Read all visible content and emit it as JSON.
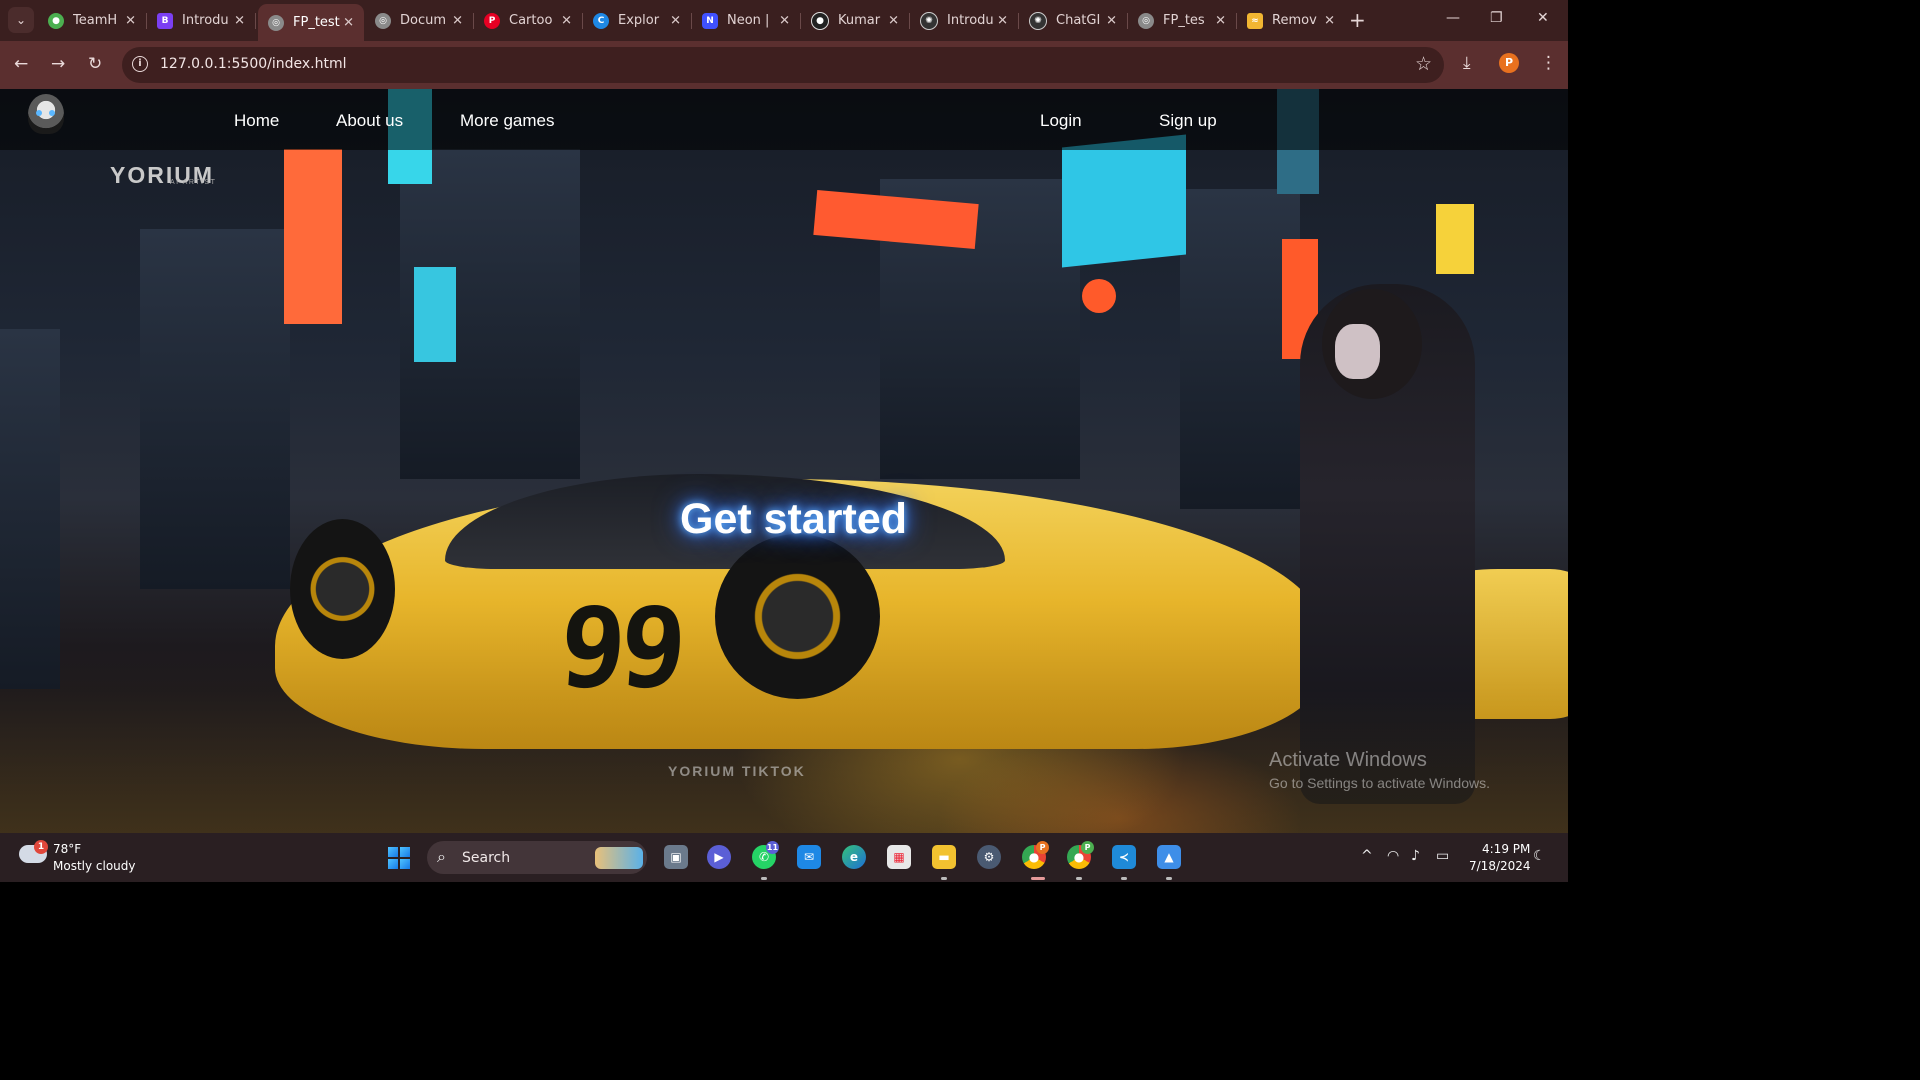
{
  "browser": {
    "tabs": [
      {
        "title": "TeamH",
        "icon": "teamh-favicon",
        "color": "#4caf50"
      },
      {
        "title": "Introdu",
        "icon": "bootstrap-favicon",
        "color": "#7b3ff2"
      },
      {
        "title": "FP_test",
        "icon": "globe-favicon",
        "color": "#8a8a8a",
        "active": true
      },
      {
        "title": "Docum",
        "icon": "globe-favicon",
        "color": "#8a8a8a"
      },
      {
        "title": "Cartoo",
        "icon": "pinterest-favicon",
        "color": "#e60023"
      },
      {
        "title": "Explor",
        "icon": "explore-favicon",
        "color": "#1e88e5"
      },
      {
        "title": "Neon |",
        "icon": "neon-favicon",
        "color": "#3f51ff"
      },
      {
        "title": "Kumar",
        "icon": "github-favicon",
        "color": "#222222"
      },
      {
        "title": "Introdu",
        "icon": "openai-favicon",
        "color": "#333333"
      },
      {
        "title": "ChatGI",
        "icon": "openai-favicon",
        "color": "#333333"
      },
      {
        "title": "FP_tes",
        "icon": "globe-favicon",
        "color": "#8a8a8a"
      },
      {
        "title": "Remov",
        "icon": "remove-favicon",
        "color": "#f2b632"
      }
    ],
    "url": "127.0.0.1:5500/index.html",
    "profile_initial": "P"
  },
  "site": {
    "nav": {
      "home": "Home",
      "about": "About us",
      "more_games": "More games",
      "login": "Login",
      "signup": "Sign up"
    },
    "brand": "YORIUM",
    "brand_sub": "AI ARTIST",
    "cta": "Get started",
    "car_number": "99",
    "watermark": "YORIUM TIKTOK",
    "activation": {
      "title": "Activate Windows",
      "subtitle": "Go to Settings to activate Windows."
    }
  },
  "taskbar": {
    "weather": {
      "temp": "78°F",
      "desc": "Mostly cloudy",
      "alert_count": "1"
    },
    "search_label": "Search",
    "whatsapp_badge": "11",
    "clock": {
      "time": "4:19 PM",
      "date": "7/18/2024"
    }
  }
}
